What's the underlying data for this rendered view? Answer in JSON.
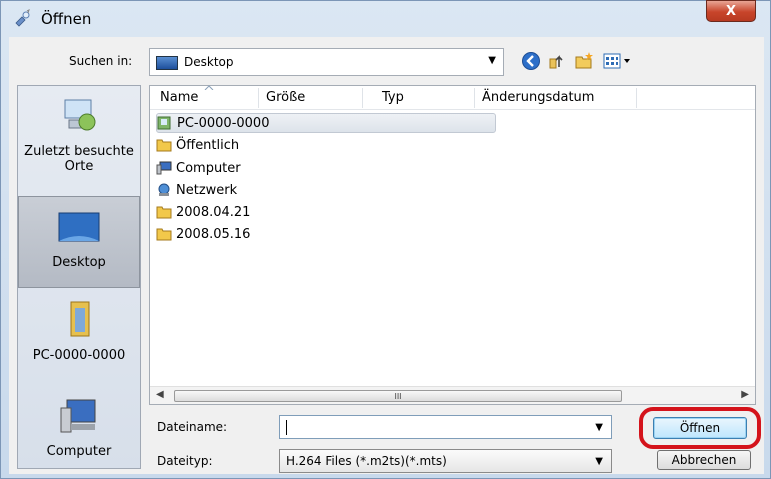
{
  "window": {
    "title": "Öffnen",
    "close_label": "X"
  },
  "toolbar": {
    "look_in_label": "Suchen in:",
    "look_in_value": "Desktop",
    "icons": [
      "back-icon",
      "up-folder-icon",
      "new-folder-icon",
      "views-menu-icon"
    ]
  },
  "places": [
    {
      "label": "Zuletzt besuchte Orte",
      "icon": "recent-places-icon",
      "selected": false
    },
    {
      "label": "Desktop",
      "icon": "desktop-icon",
      "selected": true
    },
    {
      "label": "PC-0000-0000",
      "icon": "user-folder-icon",
      "selected": false
    },
    {
      "label": "Computer",
      "icon": "computer-icon",
      "selected": false
    }
  ],
  "columns": [
    "Name",
    "Größe",
    "Typ",
    "Änderungsdatum"
  ],
  "files": [
    {
      "name": "PC-0000-0000",
      "icon": "user-folder-icon",
      "selected": true
    },
    {
      "name": "Öffentlich",
      "icon": "folder-icon",
      "selected": false
    },
    {
      "name": "Computer",
      "icon": "computer-icon",
      "selected": false
    },
    {
      "name": "Netzwerk",
      "icon": "network-icon",
      "selected": false
    },
    {
      "name": "2008.04.21",
      "icon": "folder-icon",
      "selected": false
    },
    {
      "name": "2008.05.16",
      "icon": "folder-icon",
      "selected": false
    }
  ],
  "scrollbar": {
    "thumb_grip": "III"
  },
  "filename": {
    "label": "Dateiname:",
    "value": ""
  },
  "filetype": {
    "label": "Dateityp:",
    "value": "H.264 Files (*.m2ts)(*.mts)"
  },
  "buttons": {
    "open": "Öffnen",
    "cancel": "Abbrechen"
  },
  "colors": {
    "highlight_ring": "#d4131b",
    "selection": "#dde3ea"
  }
}
